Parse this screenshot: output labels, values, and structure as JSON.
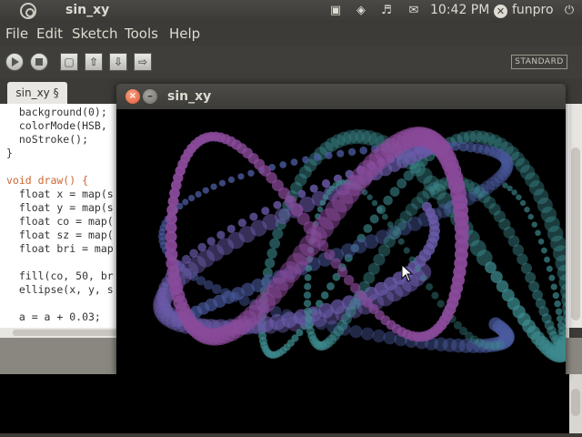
{
  "panel": {
    "window_title": "sin_xy",
    "clock": "10:42 PM",
    "user": "funpro",
    "user_icon": "x-circle-icon",
    "tray_icons": [
      "display-icon",
      "wifi-icon",
      "volume-icon",
      "mail-icon",
      "power-icon"
    ]
  },
  "menu": {
    "items": [
      "File",
      "Edit",
      "Sketch",
      "Tools",
      "Help"
    ]
  },
  "toolbar": {
    "buttons": [
      "run",
      "stop",
      "new",
      "open",
      "save",
      "export"
    ],
    "mode": "STANDARD"
  },
  "editor": {
    "tab_label": "sin_xy §",
    "lines": [
      "  background(0);",
      "  colorMode(HSB, ",
      "  noStroke();",
      "}",
      "",
      "void draw() {",
      "  float x = map(s",
      "  float y = map(s",
      "  float co = map(",
      "  float sz = map(",
      "  float bri = map",
      "",
      "  fill(co, 50, br",
      "  ellipse(x, y, s",
      "",
      "  a = a + 0.03;"
    ]
  },
  "sketch_window": {
    "title": "sin_xy",
    "colors": {
      "background": "#000000",
      "purple": "#8a4a9a",
      "violet": "#6a5aa8",
      "blue": "#4a5a9e",
      "teal": "#3d8a8e"
    }
  }
}
